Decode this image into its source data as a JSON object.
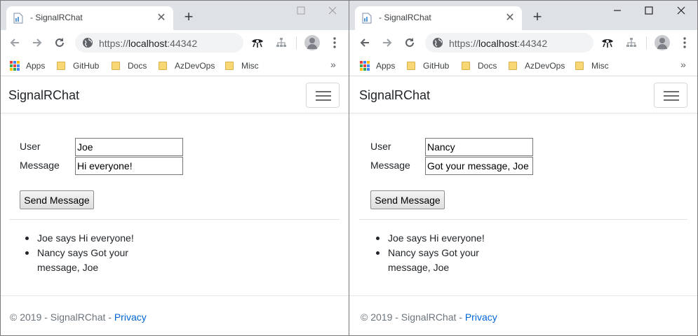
{
  "browser": {
    "tab_title": "- SignalRChat",
    "url_scheme": "https://",
    "url_host": "localhost",
    "url_port": ":44342",
    "bookmarks": [
      "Apps",
      "GitHub",
      "Docs",
      "AzDevOps",
      "Misc"
    ],
    "bookmarks_more": "»"
  },
  "page": {
    "brand": "SignalRChat",
    "user_label": "User",
    "message_label": "Message",
    "send_button": "Send Message",
    "footer_text": "© 2019 - SignalRChat - ",
    "footer_link": "Privacy"
  },
  "windows": [
    {
      "user_value": "Joe",
      "message_value": "Hi everyone!",
      "messages": [
        "Joe says Hi everyone!",
        "Nancy says Got your message, Joe"
      ]
    },
    {
      "user_value": "Nancy",
      "message_value": "Got your message, Joe",
      "messages": [
        "Joe says Hi everyone!",
        "Nancy says Got your message, Joe"
      ]
    }
  ],
  "colors": {
    "tabstrip": "#dee1e6",
    "omnibox": "#f1f3f4",
    "link": "#0366d6",
    "folder": "#f8d775"
  }
}
